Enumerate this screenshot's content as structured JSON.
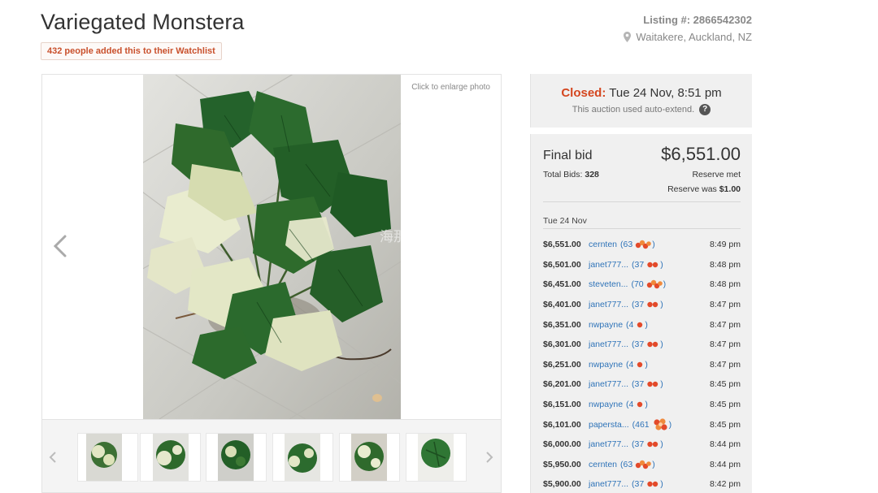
{
  "listing": {
    "title": "Variegated Monstera",
    "watchlist": "432 people added this to their Watchlist",
    "listing_number": "Listing #: 2866542302",
    "location": "Waitakere, Auckland, NZ"
  },
  "gallery": {
    "enlarge_hint": "Click to enlarge photo",
    "watermark": "海那也 Hiinabian",
    "thumb_count": 6
  },
  "auction": {
    "closed_label": "Closed:",
    "closed_time": "Tue 24 Nov, 8:51 pm",
    "auto_extend": "This auction used auto-extend.",
    "help_glyph": "?",
    "final_label": "Final bid",
    "final_amount": "$6,551.00",
    "total_bids_label": "Total Bids:",
    "total_bids": "328",
    "reserve_met": "Reserve met",
    "reserve_was_label": "Reserve was",
    "reserve_was": "$1.00",
    "date_heading": "Tue 24 Nov"
  },
  "bids": [
    {
      "amount": "$6,551.00",
      "bidder": "cernten",
      "rating": "(63",
      "badge": "multi",
      "time": "8:49 pm"
    },
    {
      "amount": "$6,501.00",
      "bidder": "janet777...",
      "rating": "(37",
      "badge": "double",
      "time": "8:48 pm"
    },
    {
      "amount": "$6,451.00",
      "bidder": "steveten...",
      "rating": "(70",
      "badge": "multi",
      "time": "8:48 pm"
    },
    {
      "amount": "$6,401.00",
      "bidder": "janet777...",
      "rating": "(37",
      "badge": "double",
      "time": "8:47 pm"
    },
    {
      "amount": "$6,351.00",
      "bidder": "nwpayne",
      "rating": "(4",
      "badge": "single",
      "time": "8:47 pm"
    },
    {
      "amount": "$6,301.00",
      "bidder": "janet777...",
      "rating": "(37",
      "badge": "double",
      "time": "8:47 pm"
    },
    {
      "amount": "$6,251.00",
      "bidder": "nwpayne",
      "rating": "(4",
      "badge": "single",
      "time": "8:47 pm"
    },
    {
      "amount": "$6,201.00",
      "bidder": "janet777...",
      "rating": "(37",
      "badge": "double",
      "time": "8:45 pm"
    },
    {
      "amount": "$6,151.00",
      "bidder": "nwpayne",
      "rating": "(4",
      "badge": "single",
      "time": "8:45 pm"
    },
    {
      "amount": "$6,101.00",
      "bidder": "papersta...",
      "rating": "(461",
      "badge": "large",
      "time": "8:45 pm"
    },
    {
      "amount": "$6,000.00",
      "bidder": "janet777...",
      "rating": "(37",
      "badge": "double",
      "time": "8:44 pm"
    },
    {
      "amount": "$5,950.00",
      "bidder": "cernten",
      "rating": "(63",
      "badge": "multi",
      "time": "8:44 pm"
    },
    {
      "amount": "$5,900.00",
      "bidder": "janet777...",
      "rating": "(37",
      "badge": "double",
      "time": "8:42 pm"
    }
  ],
  "colors": {
    "accent": "#d4461f",
    "link": "#2e73b8",
    "panel_bg": "#f0f0f0"
  }
}
